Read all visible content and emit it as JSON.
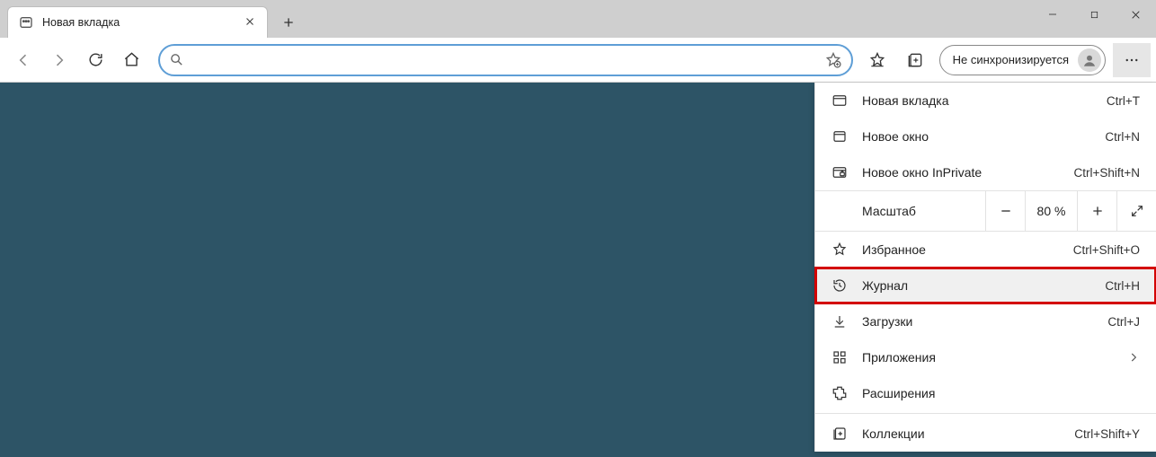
{
  "window": {
    "tab_title": "Новая вкладка",
    "sync_label": "Не синхронизируется",
    "zoom_value": "80 %",
    "address_value": "",
    "zoom_label": "Масштаб"
  },
  "menu": {
    "new_tab": {
      "label": "Новая вкладка",
      "shortcut": "Ctrl+T"
    },
    "new_window": {
      "label": "Новое окно",
      "shortcut": "Ctrl+N"
    },
    "new_inprivate": {
      "label": "Новое окно InPrivate",
      "shortcut": "Ctrl+Shift+N"
    },
    "favorites": {
      "label": "Избранное",
      "shortcut": "Ctrl+Shift+O"
    },
    "history": {
      "label": "Журнал",
      "shortcut": "Ctrl+H"
    },
    "downloads": {
      "label": "Загрузки",
      "shortcut": "Ctrl+J"
    },
    "apps": {
      "label": "Приложения",
      "shortcut": ""
    },
    "extensions": {
      "label": "Расширения",
      "shortcut": ""
    },
    "collections": {
      "label": "Коллекции",
      "shortcut": "Ctrl+Shift+Y"
    }
  }
}
